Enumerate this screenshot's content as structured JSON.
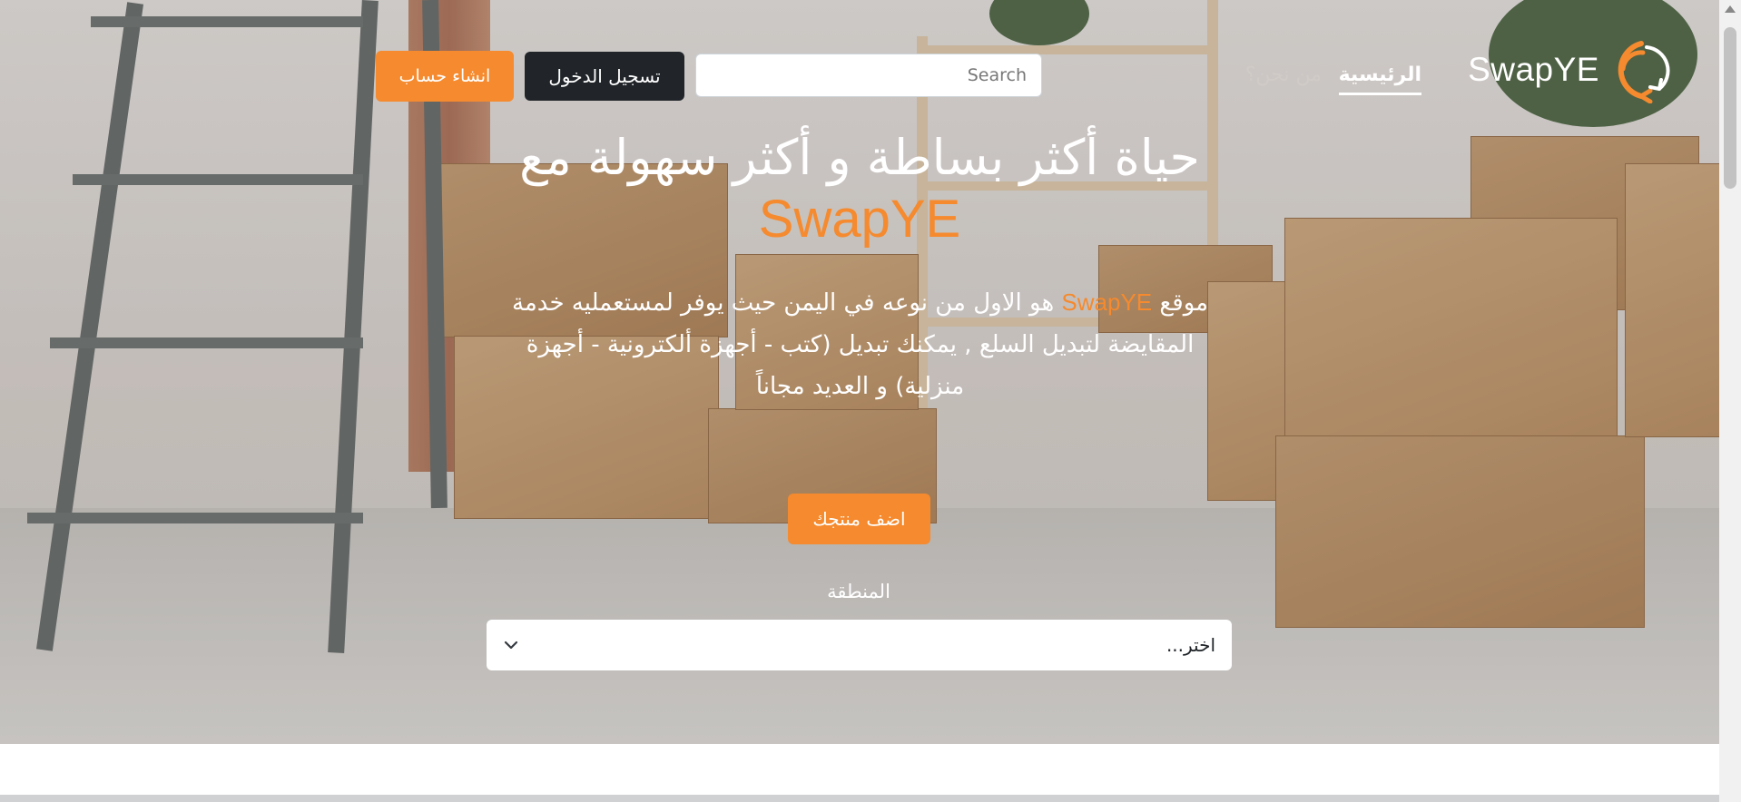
{
  "nav": {
    "logo_text": "SwapYE",
    "home_label": "الرئيسية",
    "about_label": "من نحن؟",
    "search_placeholder": "Search",
    "login_label": "تسجيل الدخول",
    "signup_label": "انشاء حساب"
  },
  "hero": {
    "headline": "حياة أكثر بساطة و أكثر سهولة مع",
    "headline_brand": "SwapYE",
    "desc_prefix": "موقع",
    "desc_brand": "SwapYE",
    "desc_rest": "هو الاول من نوعه في اليمن حيث يوفر لمستعمليه خدمة المقايضة لتبديل السلع , يمكنك تبديل (كتب - أجهزة ألكترونية - أجهزة منزلية) و العديد مجاناً",
    "add_product_label": "اضف منتجك",
    "region_label": "المنطقة",
    "region_select_value": "اختر..."
  },
  "colors": {
    "accent": "#f58a2e",
    "dark_button": "#212529",
    "white": "#ffffff"
  },
  "icons": {
    "logo": "swap-arrows-icon",
    "select": "chevron-down-icon"
  }
}
